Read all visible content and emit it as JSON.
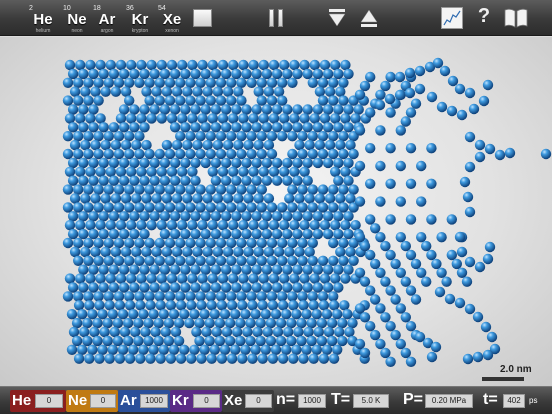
{
  "toolbar": {
    "elements": [
      {
        "number": "2",
        "symbol": "He",
        "name": "helium"
      },
      {
        "number": "10",
        "symbol": "Ne",
        "name": "neon"
      },
      {
        "number": "18",
        "symbol": "Ar",
        "name": "argon"
      },
      {
        "number": "36",
        "symbol": "Kr",
        "name": "krypton"
      },
      {
        "number": "54",
        "symbol": "Xe",
        "name": "xenon"
      }
    ],
    "help_label": "?"
  },
  "scene": {
    "scale_label": "2.0 nm",
    "atom_color": "#2f87c8"
  },
  "statusbar": {
    "counts": [
      {
        "symbol": "He",
        "value": "0",
        "color": "#8a1f1f"
      },
      {
        "symbol": "Ne",
        "value": "0",
        "color": "#c07a12"
      },
      {
        "symbol": "Ar",
        "value": "1000",
        "color": "#2a4f9a"
      },
      {
        "symbol": "Kr",
        "value": "0",
        "color": "#5a2a86"
      },
      {
        "symbol": "Xe",
        "value": "0",
        "color": "#3b3b3b"
      }
    ],
    "n_label": "n=",
    "n_value": "1000",
    "t_label": "T=",
    "t_value": "5.0 K",
    "p_label": "P=",
    "p_value": "0.20 MPa",
    "time_label": "t=",
    "time_value": "402",
    "time_unit": "ps"
  }
}
